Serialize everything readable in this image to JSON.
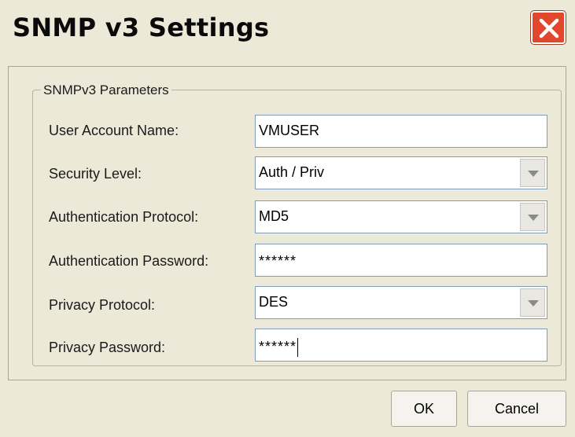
{
  "window": {
    "title": "SNMP v3 Settings",
    "close_icon": "close-icon"
  },
  "group": {
    "label": "SNMPv3 Parameters"
  },
  "fields": {
    "user_account_name": {
      "label": "User Account Name:",
      "value": "VMUSER"
    },
    "security_level": {
      "label": "Security Level:",
      "value": "Auth / Priv"
    },
    "auth_protocol": {
      "label": "Authentication Protocol:",
      "value": "MD5"
    },
    "auth_password": {
      "label": "Authentication Password:",
      "value": "******"
    },
    "privacy_protocol": {
      "label": "Privacy Protocol:",
      "value": "DES"
    },
    "privacy_password": {
      "label": "Privacy Password:",
      "value": "******"
    }
  },
  "buttons": {
    "ok": "OK",
    "cancel": "Cancel"
  },
  "colors": {
    "dialog_bg": "#ece9d8",
    "close_button": "#e0472c",
    "field_border": "#7f9db9"
  }
}
